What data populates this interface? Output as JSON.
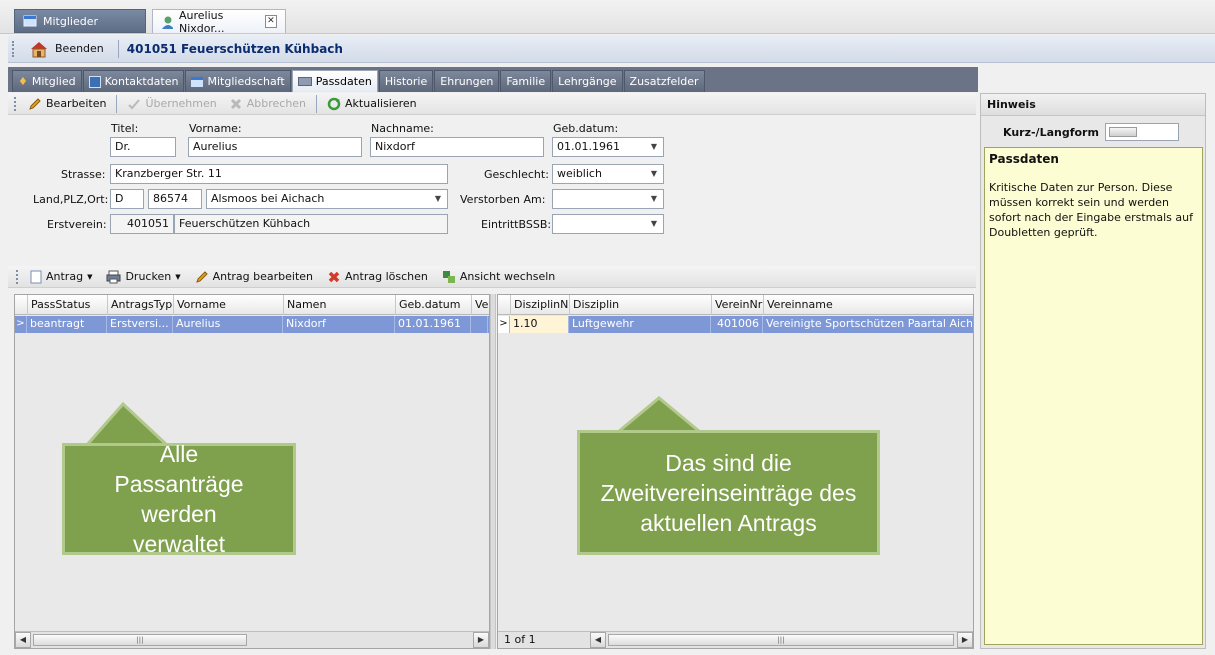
{
  "doc_tabs": [
    {
      "label": "Mitglieder"
    },
    {
      "label": "Aurelius Nixdor..."
    }
  ],
  "titlebar": {
    "beenden": "Beenden",
    "title": "401051  Feuerschützen Kühbach"
  },
  "section_tabs": [
    "Mitglied",
    "Kontaktdaten",
    "Mitgliedschaft",
    "Passdaten",
    "Historie",
    "Ehrungen",
    "Familie",
    "Lehrgänge",
    "Zusatzfelder"
  ],
  "toolbar": {
    "bearbeiten": "Bearbeiten",
    "uebernehmen": "Übernehmen",
    "abbrechen": "Abbrechen",
    "aktualisieren": "Aktualisieren"
  },
  "form": {
    "titel_label": "Titel:",
    "titel_value": "Dr.",
    "vorname_label": "Vorname:",
    "vorname_value": "Aurelius",
    "nachname_label": "Nachname:",
    "nachname_value": "Nixdorf",
    "gebdatum_label": "Geb.datum:",
    "gebdatum_value": "01.01.1961",
    "strasse_label": "Strasse:",
    "strasse_value": "Kranzberger Str. 11",
    "geschlecht_label": "Geschlecht:",
    "geschlecht_value": "weiblich",
    "land_label": "Land,PLZ,Ort:",
    "land_value": "D",
    "plz_value": "86574",
    "ort_value": "Alsmoos bei Aichach",
    "verstorben_label": "Verstorben Am:",
    "verstorben_value": "",
    "erstverein_label": "Erstverein:",
    "erstverein_nr": "401051",
    "erstverein_name": "Feuerschützen Kühbach",
    "eintritt_label": "EintrittBSSB:",
    "eintritt_value": ""
  },
  "grid_toolbar": {
    "antrag": "Antrag",
    "drucken": "Drucken",
    "antrag_bearbeiten": "Antrag bearbeiten",
    "antrag_loeschen": "Antrag löschen",
    "ansicht_wechseln": "Ansicht wechseln"
  },
  "left_grid": {
    "columns": [
      "PassStatus",
      "AntragsTyp",
      "Vorname",
      "Namen",
      "Geb.datum",
      "Vere"
    ],
    "rows": [
      [
        "beantragt",
        "Erstversi...",
        "Aurelius",
        "Nixdorf",
        "01.01.1961",
        ""
      ]
    ]
  },
  "right_grid": {
    "columns": [
      "DisziplinNr",
      "Disziplin",
      "VereinNr",
      "Vereinname"
    ],
    "rows": [
      [
        "1.10",
        "Luftgewehr",
        "401006",
        "Vereinigte Sportschützen Paartal Aich"
      ]
    ],
    "pager": "1 of 1"
  },
  "callouts": {
    "left": "Alle Passanträge werden verwaltet",
    "right": "Das sind die Zweitvereinseinträge des aktuellen Antrags"
  },
  "hint": {
    "header": "Hinweis",
    "toggle_label": "Kurz-/Langform",
    "title": "Passdaten",
    "text": "Kritische Daten zur Person. Diese müssen korrekt sein und werden sofort nach der Eingabe erstmals auf Doubletten geprüft."
  },
  "colors": {
    "callout": "#7fa04d",
    "selected_row": "#7e97d6",
    "hint_bg": "#fdfdd3",
    "title": "#0b2c6e"
  }
}
